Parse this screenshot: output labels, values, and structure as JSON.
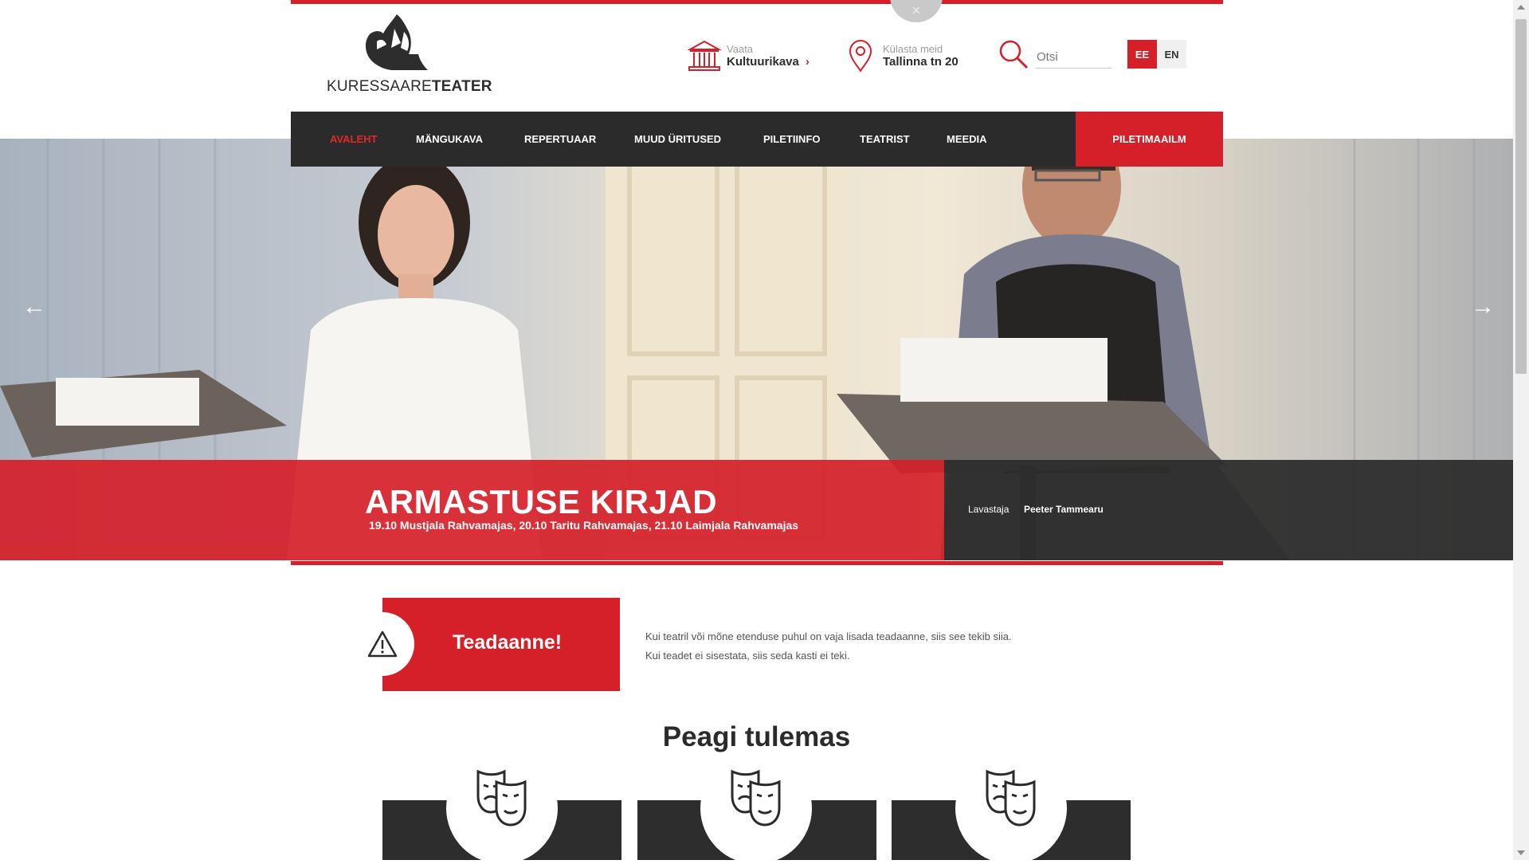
{
  "header": {
    "logo_text_light": "KURESSAARE",
    "logo_text_bold": "TEATER",
    "culture_label": "Vaata",
    "culture_link": "Kultuurikava",
    "visit_label": "Külasta meid",
    "visit_address": "Tallinna tn 20",
    "search_placeholder": "Otsi",
    "lang_ee": "EE",
    "lang_en": "EN",
    "close_symbol": "×"
  },
  "nav": {
    "items": [
      "AVALEHT",
      "MÄNGUKAVA",
      "REPERTUAAR",
      "MUUD ÜRITUSED",
      "PILETIINFO",
      "TEATRIST",
      "MEEDIA"
    ],
    "active_index": 0,
    "ticket_button": "PILETIMAAILM"
  },
  "hero": {
    "title": "ARMASTUSE KIRJAD",
    "dates": "19.10 Mustjala Rahvamajas, 20.10 Taritu Rahvamajas, 21.10 Laimjala Rahvamajas",
    "director_label": "Lavastaja",
    "director_name": "Peeter Tammearu",
    "prev_arrow": "←",
    "next_arrow": "→"
  },
  "notice": {
    "title": "Teadaanne!",
    "text": "Kui teatril või mõne etenduse puhul on vaja lisada teadaanne, siis see tekib siia. Kui teadet ei sisestata, siis seda kasti ei teki."
  },
  "coming_soon": {
    "title": "Peagi tulemas",
    "card_icon": "theatre-masks-icon"
  },
  "colors": {
    "accent_red": "#d52029",
    "dark": "#2b2b2b"
  }
}
